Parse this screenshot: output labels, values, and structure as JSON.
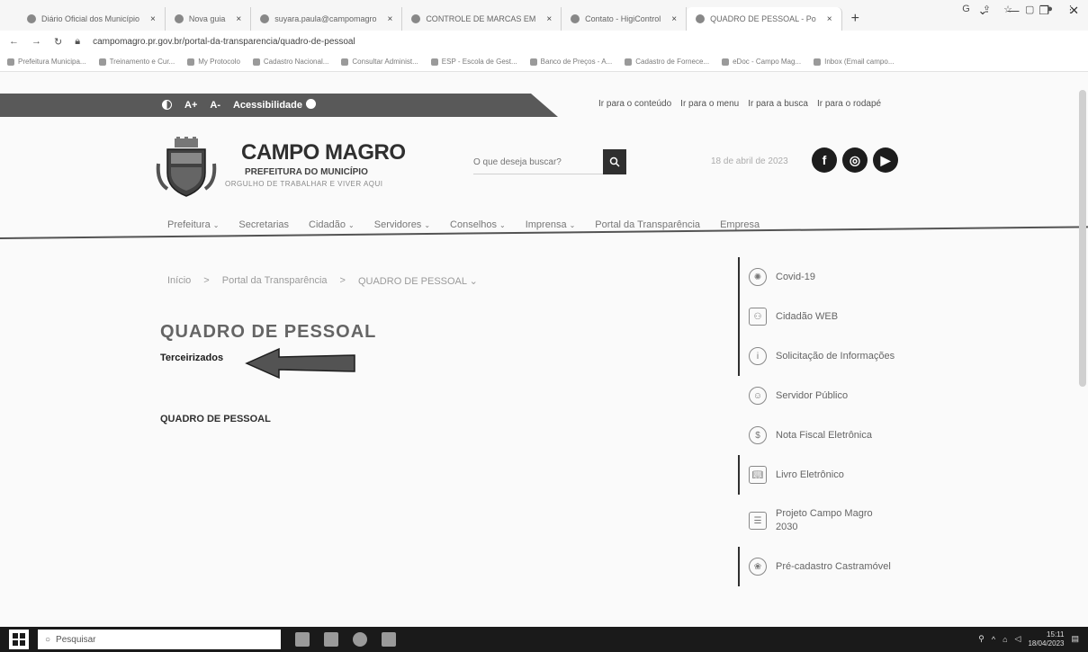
{
  "browser": {
    "tabs": [
      {
        "label": "Diário Oficial dos Município"
      },
      {
        "label": "Nova guia"
      },
      {
        "label": "suyara.paula@campomagro"
      },
      {
        "label": "CONTROLE DE MARCAS EM"
      },
      {
        "label": "Contato - HigiControl"
      },
      {
        "label": "QUADRO DE PESSOAL - Po",
        "active": true
      }
    ],
    "new_tab": "+",
    "url": "campomagro.pr.gov.br/portal-da-transparencia/quadro-de-pessoal",
    "bookmarks": [
      "Prefeitura Municipa...",
      "Treinamento e Cur...",
      "My Protocolo",
      "Cadastro Nacional...",
      "Consultar Administ...",
      "ESP - Escola de Gest...",
      "Banco de Preços - A...",
      "Cadastro de Fornece...",
      "eDoc - Campo Mag...",
      "Inbox (Email campo..."
    ]
  },
  "accessibility": {
    "font_increase": "A+",
    "font_decrease": "A-",
    "label": "Acessibilidade",
    "skip_links": [
      "Ir para o conteúdo",
      "Ir para o menu",
      "Ir para a busca",
      "Ir para o rodapé"
    ]
  },
  "header": {
    "title": "CAMPO MAGRO",
    "subtitle": "PREFEITURA DO MUNICÍPIO",
    "tagline": "ORGULHO DE TRABALHAR E VIVER AQUI",
    "search_placeholder": "O que deseja buscar?",
    "date": "18 de abril de 2023"
  },
  "nav": {
    "items": [
      {
        "label": "Prefeitura",
        "dropdown": true
      },
      {
        "label": "Secretarias",
        "dropdown": false
      },
      {
        "label": "Cidadão",
        "dropdown": true
      },
      {
        "label": "Servidores",
        "dropdown": true
      },
      {
        "label": "Conselhos",
        "dropdown": true
      },
      {
        "label": "Imprensa",
        "dropdown": true
      },
      {
        "label": "Portal da Transparência",
        "dropdown": false
      },
      {
        "label": "Empresa",
        "dropdown": false
      }
    ]
  },
  "breadcrumb": {
    "home": "Início",
    "sep": ">",
    "portal": "Portal da Transparência",
    "current": "QUADRO DE PESSOAL"
  },
  "main": {
    "title": "QUADRO DE PESSOAL",
    "subtitle": "Terceirizados",
    "link": "QUADRO DE PESSOAL"
  },
  "sidebar": {
    "items": [
      {
        "label": "Covid-19",
        "icon": "virus-icon"
      },
      {
        "label": "Cidadão WEB",
        "icon": "people-icon"
      },
      {
        "label": "Solicitação de Informações",
        "icon": "info-icon"
      },
      {
        "label": "Servidor Público",
        "icon": "user-icon"
      },
      {
        "label": "Nota Fiscal Eletrônica",
        "icon": "invoice-icon"
      },
      {
        "label": "Livro Eletrônico",
        "icon": "book-icon"
      },
      {
        "label": "Projeto Campo Magro 2030",
        "icon": "clipboard-icon"
      },
      {
        "label": "Pré-cadastro Castramóvel",
        "icon": "paw-icon"
      }
    ]
  },
  "taskbar": {
    "search_placeholder": "Pesquisar",
    "time": "15:11",
    "date": "18/04/2023"
  }
}
